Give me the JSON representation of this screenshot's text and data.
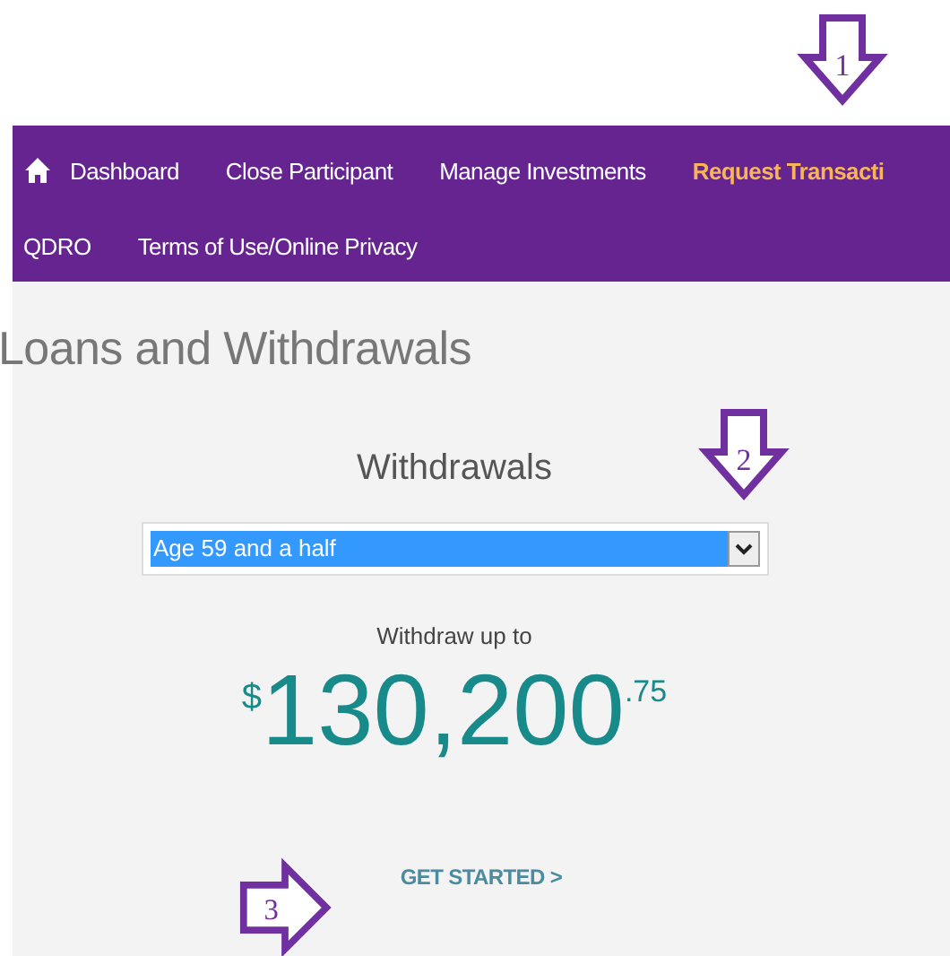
{
  "nav": {
    "rows": [
      {
        "items": [
          {
            "label": "Dashboard",
            "selected": false,
            "kind": "home"
          },
          {
            "label": "Close Participant",
            "selected": false
          },
          {
            "label": "Manage Investments",
            "selected": false
          },
          {
            "label": "Request Transacti",
            "selected": true
          }
        ]
      },
      {
        "items": [
          {
            "label": "QDRO",
            "selected": false
          },
          {
            "label": "Terms of Use/Online Privacy",
            "selected": false
          }
        ]
      }
    ]
  },
  "page_title": "Loans and Withdrawals",
  "section_title": "Withdrawals",
  "dropdown": {
    "value": "Age 59 and a half",
    "highlighted": true
  },
  "amount": {
    "caption": "Withdraw up to",
    "currency": "$",
    "whole": "130,200",
    "cents": ".75"
  },
  "link": "GET STARTED >",
  "callouts": [
    {
      "number": "1",
      "kind": "down"
    },
    {
      "number": "2",
      "kind": "down"
    },
    {
      "number": "3",
      "kind": "right"
    }
  ]
}
